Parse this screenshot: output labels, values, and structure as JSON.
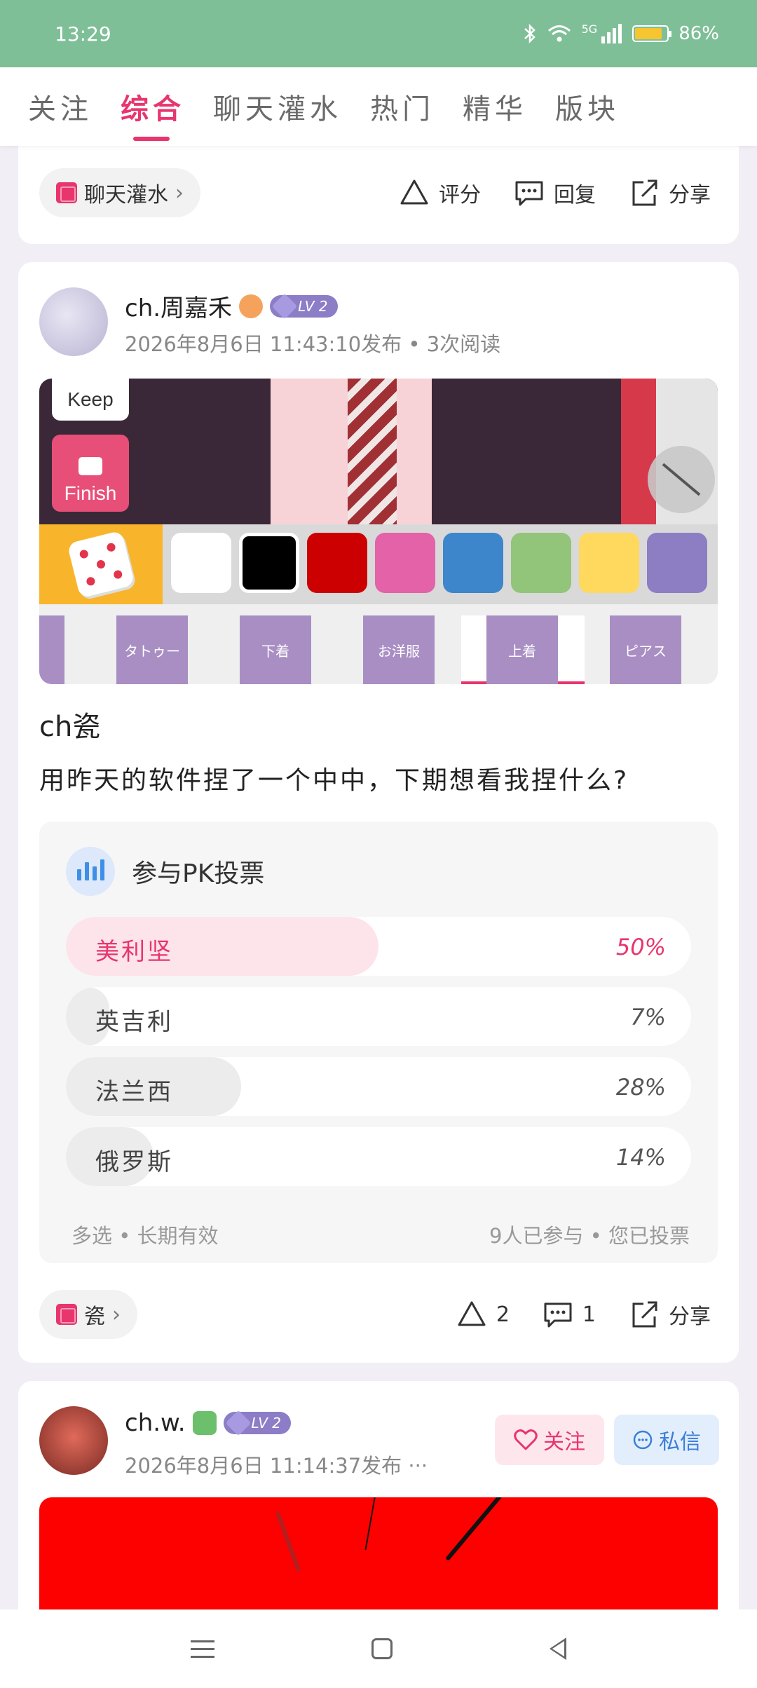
{
  "status_bar": {
    "time": "13:29",
    "battery": "86%",
    "network": "5G",
    "battery_level": 0.86
  },
  "tabs": [
    {
      "label": "关注",
      "active": false
    },
    {
      "label": "综合",
      "active": true
    },
    {
      "label": "聊天灌水",
      "active": false
    },
    {
      "label": "热门",
      "active": false
    },
    {
      "label": "精华",
      "active": false
    },
    {
      "label": "版块",
      "active": false
    }
  ],
  "prev_post": {
    "topic": "聊天灌水",
    "rate_label": "评分",
    "reply_label": "回复",
    "share_label": "分享"
  },
  "post": {
    "username": "ch.周嘉禾",
    "level": "LV 2",
    "meta": "2026年8月6日 11:43:10发布 • 3次阅读",
    "image": {
      "keep_label": "Keep",
      "finish_label": "Finish",
      "swatches": [
        "#ffffff",
        "#000000",
        "#cc0000",
        "#e362a8",
        "#3d86cc",
        "#92c47a",
        "#ffd85e",
        "#8d7ec4"
      ],
      "clothing_tabs": [
        "タトゥー",
        "下着",
        "お洋服",
        "上着",
        "ピアス"
      ],
      "selected_clothing_tab": "上着"
    },
    "title": "ch瓷",
    "text": "用昨天的软件捏了一个中中，下期想看我捏什么?",
    "poll": {
      "heading": "参与PK投票",
      "options": [
        {
          "label": "美利坚",
          "percent_label": "50%",
          "percent": 50,
          "selected": true
        },
        {
          "label": "英吉利",
          "percent_label": "7%",
          "percent": 7,
          "selected": false
        },
        {
          "label": "法兰西",
          "percent_label": "28%",
          "percent": 28,
          "selected": false
        },
        {
          "label": "俄罗斯",
          "percent_label": "14%",
          "percent": 14,
          "selected": false
        }
      ],
      "footer_left": "多选 • 长期有效",
      "footer_right": "9人已参与 • 您已投票"
    },
    "topic": "瓷",
    "rate_count": "2",
    "reply_count": "1",
    "share_label": "分享"
  },
  "next_post": {
    "username": "ch.w.",
    "level": "LV 2",
    "meta": "2026年8月6日 11:14:37发布 ···",
    "follow_label": "关注",
    "message_label": "私信"
  },
  "colors": {
    "accent": "#e8356d",
    "status_bar": "#7fbf98",
    "level_badge": "#8c7dc6",
    "poll_icon": "#3f8fe6"
  },
  "icons": [
    "bluetooth-icon",
    "wifi-icon",
    "signal-icon",
    "battery-icon",
    "rate-icon",
    "comment-icon",
    "share-icon",
    "heart-icon",
    "chat-bubble-icon",
    "chart-icon",
    "chevron-right-icon"
  ]
}
